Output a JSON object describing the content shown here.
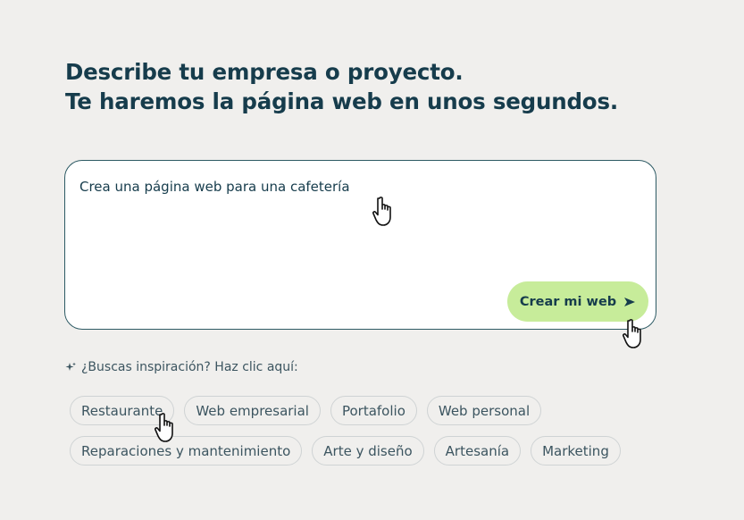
{
  "headline": {
    "line1": "Describe tu empresa o proyecto.",
    "line2": "Te haremos la página web en unos segundos."
  },
  "prompt": {
    "value": "Crea una página web para una cafetería",
    "button_label": "Crear mi web",
    "button_icon": "send-arrow-icon"
  },
  "inspiration": {
    "icon": "sparkle-icon",
    "label": "¿Buscas inspiración? Haz clic aquí:"
  },
  "chips": [
    [
      "Restaurante",
      "Web empresarial",
      "Portafolio",
      "Web personal"
    ],
    [
      "Reparaciones y mantenimiento",
      "Arte y diseño",
      "Artesanía",
      "Marketing"
    ]
  ],
  "colors": {
    "background": "#f0efed",
    "text": "#163c4c",
    "accent_button": "#c7ec9a",
    "box_border": "#2d5a64",
    "chip_border": "#cfd3d4"
  },
  "cursor_icon": "hand-pointer-icon"
}
